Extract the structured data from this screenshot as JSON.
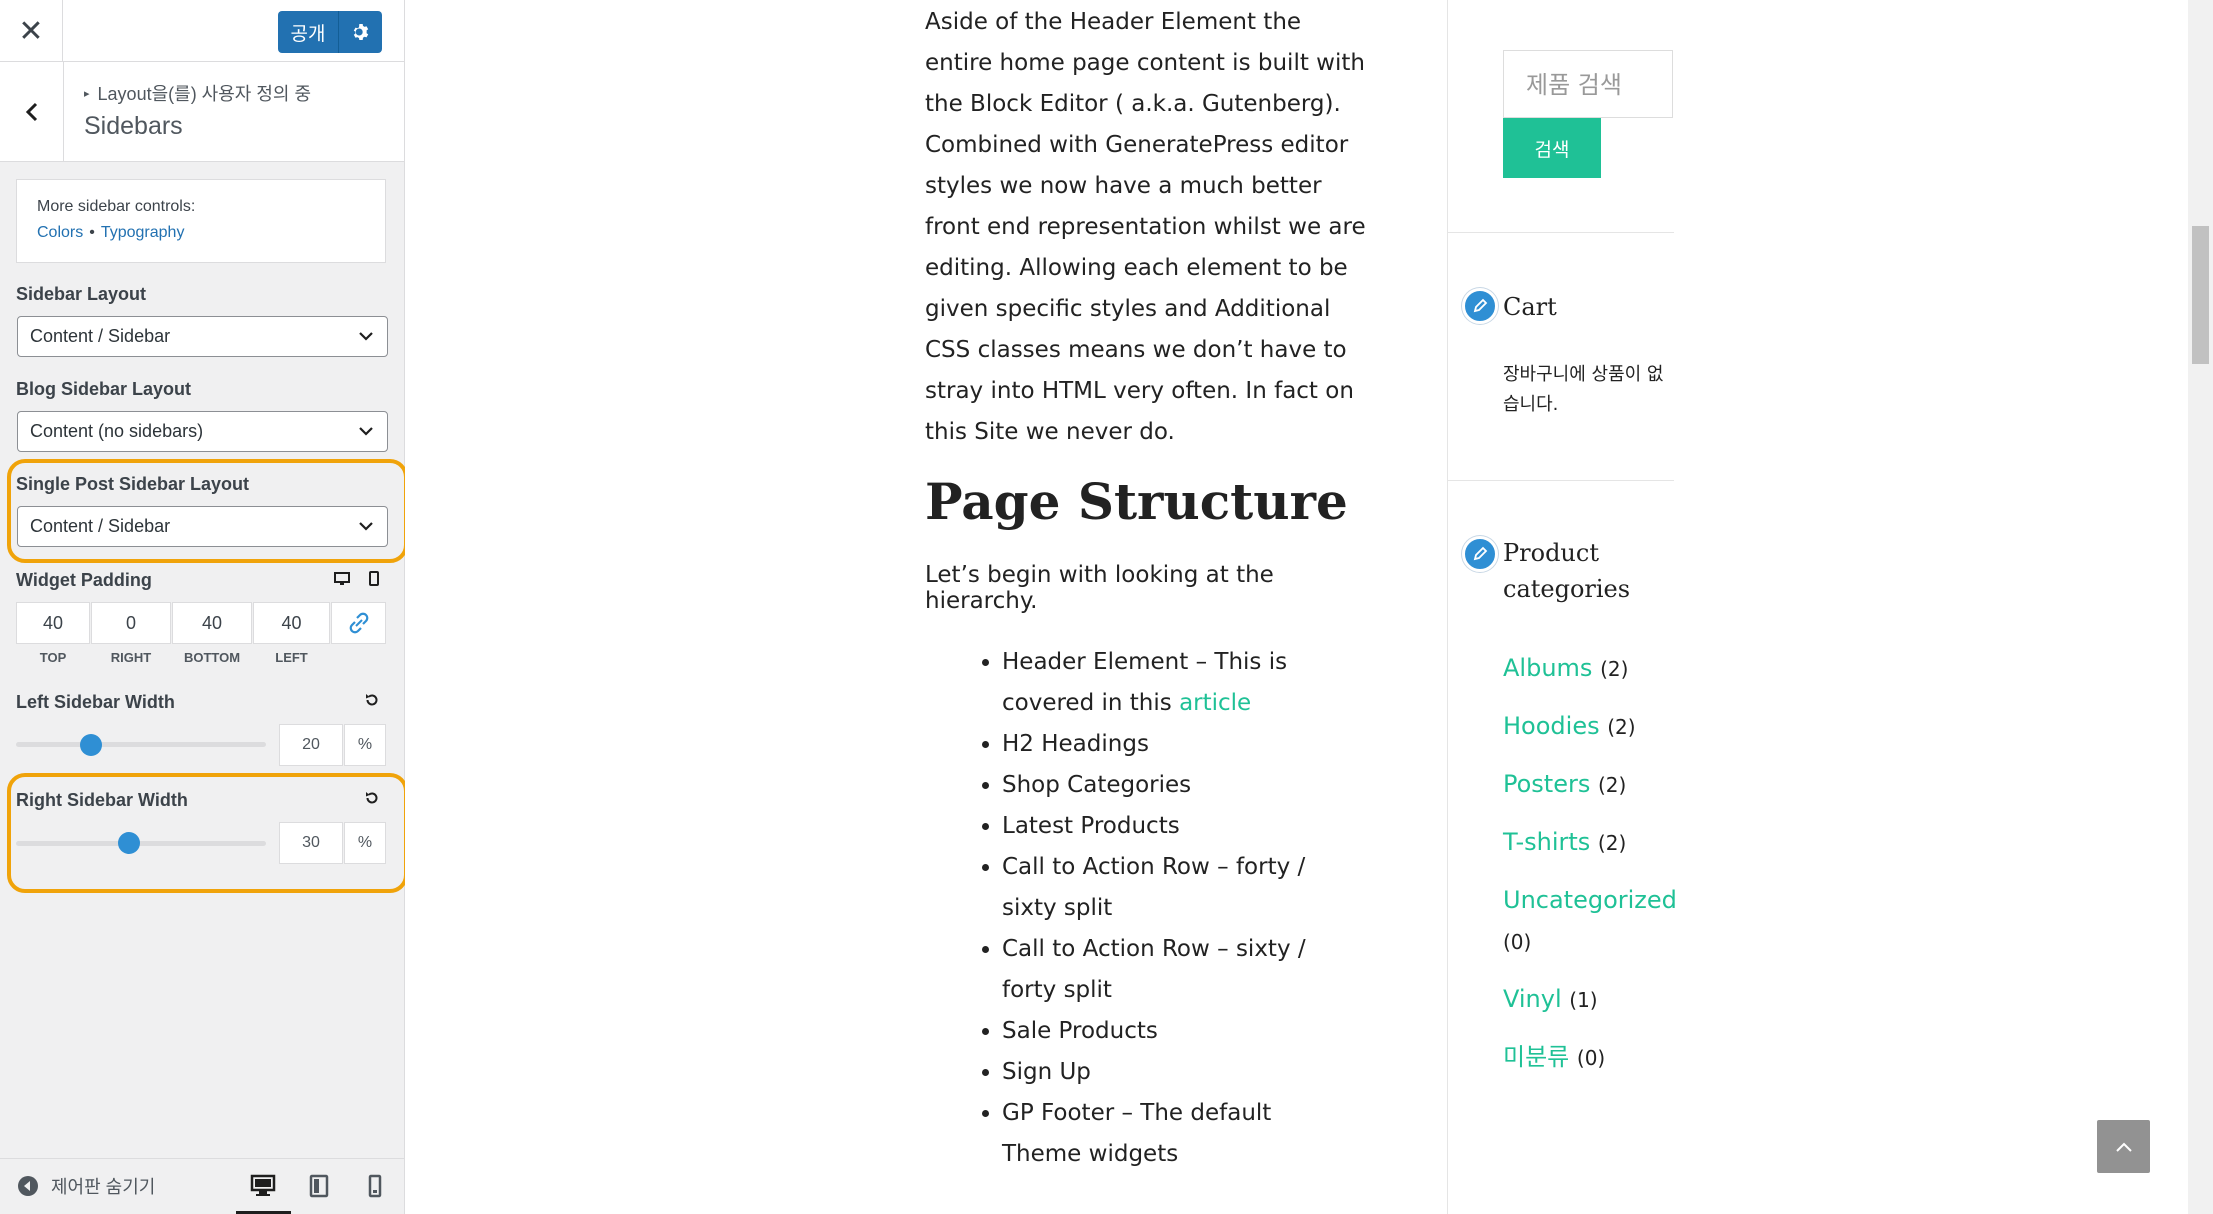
{
  "panel": {
    "publish_label": "공개",
    "breadcrumb": "Layout을(를) 사용자 정의 중",
    "section_title": "Sidebars",
    "more_controls": {
      "text": "More sidebar controls:",
      "colors_link": "Colors",
      "separator": "•",
      "typography_link": "Typography"
    },
    "sidebar_layout": {
      "label": "Sidebar Layout",
      "value": "Content / Sidebar"
    },
    "blog_sidebar_layout": {
      "label": "Blog Sidebar Layout",
      "value": "Content (no sidebars)"
    },
    "single_post_sidebar_layout": {
      "label": "Single Post Sidebar Layout",
      "value": "Content / Sidebar"
    },
    "widget_padding": {
      "label": "Widget Padding",
      "top": "40",
      "right": "0",
      "bottom": "40",
      "left": "40",
      "top_label": "TOP",
      "right_label": "RIGHT",
      "bottom_label": "BOTTOM",
      "left_label": "LEFT"
    },
    "left_sidebar_width": {
      "label": "Left Sidebar Width",
      "value": "20",
      "unit": "%",
      "fraction": 0.2
    },
    "right_sidebar_width": {
      "label": "Right Sidebar Width",
      "value": "30",
      "unit": "%",
      "fraction": 0.3
    },
    "hide_controls_label": "제어판 숨기기",
    "colors": {
      "accent": "#2271b1",
      "highlight": "#f0a30a",
      "slider": "#2f8fd4"
    }
  },
  "preview": {
    "intro": "Aside of the Header Element the entire home page content is built with the Block Editor ( a.k.a. Gutenberg). Combined with GeneratePress editor styles we now have a much better front end representation whilst we are editing. Allowing each element to be given specific styles and Additional CSS classes means we don’t have to stray into HTML very often. In fact on this Site we never do.",
    "heading": "Page Structure",
    "hierarchy_text": "Let’s begin with looking at the hierarchy.",
    "list": {
      "item1_text": "Header Element – This is covered in this ",
      "item1_link": "article",
      "item2": "H2 Headings",
      "item3": "Shop Categories",
      "item4": "Latest Products",
      "item5": "Call to Action Row – forty / sixty split",
      "item6": "Call to Action Row – sixty / forty split",
      "item7": "Sale Products",
      "item8": "Sign Up",
      "item9": "GP Footer – The default Theme widgets"
    },
    "sidebar": {
      "search_placeholder": "제품 검색",
      "search_button": "검색",
      "cart_title": "Cart",
      "cart_empty": "장바구니에 상품이 없습니다.",
      "categories_title": "Product categories",
      "categories": [
        {
          "name": "Albums",
          "count": "(2)"
        },
        {
          "name": "Hoodies",
          "count": "(2)"
        },
        {
          "name": "Posters",
          "count": "(2)"
        },
        {
          "name": "T-shirts",
          "count": "(2)"
        },
        {
          "name": "Uncategorized",
          "count": "(0)"
        },
        {
          "name": "Vinyl",
          "count": "(1)"
        },
        {
          "name": "미분류",
          "count": "(0)"
        }
      ],
      "link_color": "#1fc196"
    }
  }
}
